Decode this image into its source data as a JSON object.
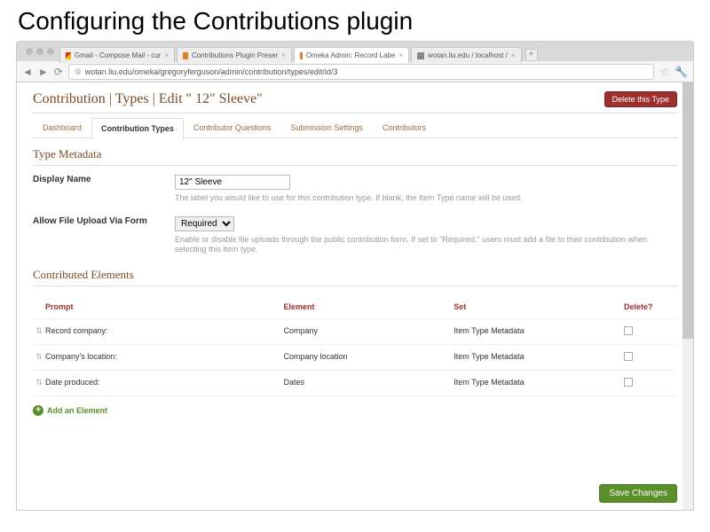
{
  "slide": {
    "title": "Configuring the Contributions plugin"
  },
  "browser": {
    "tabs": [
      {
        "label": "Gmail - Compose Mail - cur",
        "fav": "fav-gm"
      },
      {
        "label": "Contributions Plugin Preser",
        "fav": "fav-or"
      },
      {
        "label": "Omeka Admin: Record Labe",
        "fav": "fav-or"
      },
      {
        "label": "wotan.liu.edu / localhost /",
        "fav": "fav-sq"
      }
    ],
    "url": "wotan.liu.edu/omeka/gregoryferguson/admin/contribution/types/edit/id/3"
  },
  "page": {
    "title": "Contribution | Types | Edit \" 12\" Sleeve\"",
    "delete_label": "Delete this Type",
    "save_label": "Save Changes",
    "tabs": [
      "Dashboard",
      "Contribution Types",
      "Contributor Questions",
      "Submission Settings",
      "Contributors"
    ],
    "active_tab": 1,
    "type_metadata_heading": "Type Metadata",
    "display_name": {
      "label": "Display Name",
      "value": "12\" Sleeve",
      "help": "The label you would like to use for this contribution type. If blank, the Item Type name will be used."
    },
    "file_upload": {
      "label": "Allow File Upload Via Form",
      "value": "Required",
      "help": "Enable or disable file uploads through the public contribution form. If set to \"Required,\" users must add a file to their contribution when selecting this item type."
    },
    "contributed_heading": "Contributed Elements",
    "columns": {
      "prompt": "Prompt",
      "element": "Element",
      "set": "Set",
      "delete": "Delete?"
    },
    "rows": [
      {
        "prompt": "Record company:",
        "element": "Company",
        "set": "Item Type Metadata"
      },
      {
        "prompt": "Company's location:",
        "element": "Company location",
        "set": "Item Type Metadata"
      },
      {
        "prompt": "Date produced:",
        "element": "Dates",
        "set": "Item Type Metadata"
      }
    ],
    "add_element": "Add an Element"
  }
}
